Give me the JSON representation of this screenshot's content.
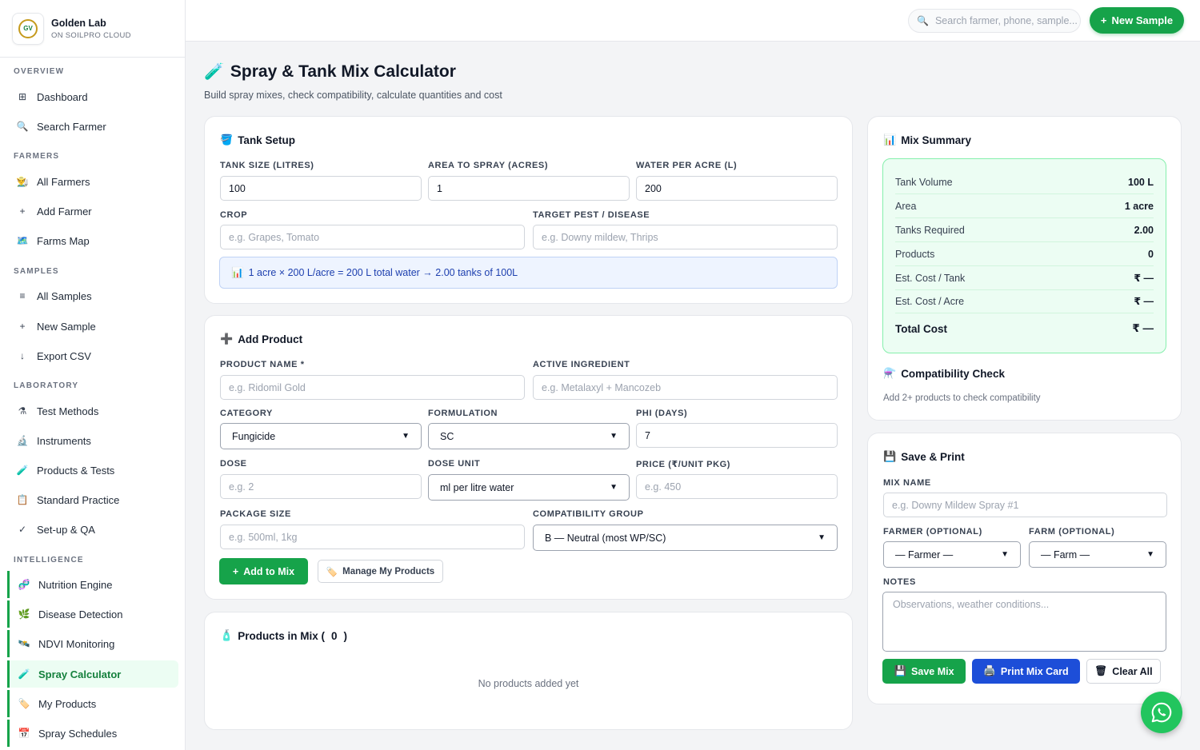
{
  "brand": {
    "name": "Golden Lab",
    "subtitle": "ON SOILPRO CLOUD",
    "logo_text": "GV"
  },
  "nav": {
    "sections": {
      "overview": "OVERVIEW",
      "farmers": "FARMERS",
      "samples": "SAMPLES",
      "laboratory": "LABORATORY",
      "intelligence": "INTELLIGENCE"
    },
    "items": {
      "dashboard": {
        "label": "Dashboard",
        "icon": "grid-icon",
        "glyph": "⊞"
      },
      "search_farmer": {
        "label": "Search Farmer",
        "icon": "search-icon",
        "glyph": "🔍"
      },
      "all_farmers": {
        "label": "All Farmers",
        "icon": "farmer-icon",
        "glyph": "👨‍🌾"
      },
      "add_farmer": {
        "label": "Add Farmer",
        "icon": "plus-icon",
        "glyph": "+"
      },
      "farms_map": {
        "label": "Farms Map",
        "icon": "map-icon",
        "glyph": "🗺️"
      },
      "all_samples": {
        "label": "All Samples",
        "icon": "list-icon",
        "glyph": "≡"
      },
      "new_sample": {
        "label": "New Sample",
        "icon": "plus-icon",
        "glyph": "+"
      },
      "export_csv": {
        "label": "Export CSV",
        "icon": "download-icon",
        "glyph": "↓"
      },
      "test_methods": {
        "label": "Test Methods",
        "icon": "flask-icon",
        "glyph": "⚗"
      },
      "instruments": {
        "label": "Instruments",
        "icon": "microscope-icon",
        "glyph": "🔬"
      },
      "products_tests": {
        "label": "Products & Tests",
        "icon": "test-tube-icon",
        "glyph": "🧪"
      },
      "standard_practice": {
        "label": "Standard Practice",
        "icon": "clipboard-icon",
        "glyph": "📋"
      },
      "setup_qa": {
        "label": "Set-up & QA",
        "icon": "check-icon",
        "glyph": "✓"
      },
      "nutrition_engine": {
        "label": "Nutrition Engine",
        "icon": "dna-icon",
        "glyph": "🧬"
      },
      "disease_detection": {
        "label": "Disease Detection",
        "icon": "leaf-icon",
        "glyph": "🌿"
      },
      "ndvi_monitoring": {
        "label": "NDVI Monitoring",
        "icon": "satellite-icon",
        "glyph": "🛰️"
      },
      "spray_calculator": {
        "label": "Spray Calculator",
        "icon": "test-tube-icon",
        "glyph": "🧪"
      },
      "my_products": {
        "label": "My Products",
        "icon": "tag-icon",
        "glyph": "🏷️"
      },
      "spray_schedules": {
        "label": "Spray Schedules",
        "icon": "calendar-icon",
        "glyph": "📅"
      }
    }
  },
  "topbar": {
    "search_placeholder": "Search farmer, phone, sample...",
    "new_sample_label": "New Sample"
  },
  "page": {
    "title": "Spray & Tank Mix Calculator",
    "title_icon": "🧪",
    "subtitle": "Build spray mixes, check compatibility, calculate quantities and cost"
  },
  "tank_setup": {
    "title": "Tank Setup",
    "icon": "🪣",
    "tank_size_label": "TANK SIZE (LITRES)",
    "tank_size_value": "100",
    "area_label": "AREA TO SPRAY (ACRES)",
    "area_value": "1",
    "water_label": "WATER PER ACRE (L)",
    "water_value": "200",
    "crop_label": "CROP",
    "crop_placeholder": "e.g. Grapes, Tomato",
    "pest_label": "TARGET PEST / DISEASE",
    "pest_placeholder": "e.g. Downy mildew, Thrips",
    "info_icon": "📊",
    "info_text": "1 acre × 200 L/acre = 200 L total water → 2.00 tanks of 100L"
  },
  "add_product": {
    "title": "Add Product",
    "icon": "➕",
    "name_label": "PRODUCT NAME *",
    "name_placeholder": "e.g. Ridomil Gold",
    "ai_label": "ACTIVE INGREDIENT",
    "ai_placeholder": "e.g. Metalaxyl + Mancozeb",
    "category_label": "CATEGORY",
    "category_value": "Fungicide",
    "formulation_label": "FORMULATION",
    "formulation_value": "SC",
    "phi_label": "PHI (DAYS)",
    "phi_value": "7",
    "dose_label": "DOSE",
    "dose_placeholder": "e.g. 2",
    "dose_unit_label": "DOSE UNIT",
    "dose_unit_value": "ml per litre water",
    "price_label": "PRICE (₹/UNIT PKG)",
    "price_placeholder": "e.g. 450",
    "package_label": "PACKAGE SIZE",
    "package_placeholder": "e.g. 500ml, 1kg",
    "compat_label": "COMPATIBILITY GROUP",
    "compat_value": "B — Neutral (most WP/SC)",
    "add_button": "Add to Mix",
    "manage_button": "Manage My Products",
    "manage_icon": "🏷️"
  },
  "products_in_mix": {
    "title_prefix": "Products in Mix (",
    "count": "0",
    "title_suffix": ")",
    "icon": "🧴",
    "empty_text": "No products added yet"
  },
  "mix_summary": {
    "title": "Mix Summary",
    "icon": "📊",
    "rows": [
      {
        "label": "Tank Volume",
        "value": "100 L"
      },
      {
        "label": "Area",
        "value": "1 acre"
      },
      {
        "label": "Tanks Required",
        "value": "2.00"
      },
      {
        "label": "Products",
        "value": "0"
      },
      {
        "label": "Est. Cost / Tank",
        "value": "₹ —"
      },
      {
        "label": "Est. Cost / Acre",
        "value": "₹ —"
      },
      {
        "label": "Total Cost",
        "value": "₹ —"
      }
    ]
  },
  "compatibility": {
    "title": "Compatibility Check",
    "icon": "⚗️",
    "hint": "Add 2+ products to check compatibility"
  },
  "save_print": {
    "title": "Save & Print",
    "icon": "💾",
    "mix_name_label": "MIX NAME",
    "mix_name_placeholder": "e.g. Downy Mildew Spray #1",
    "farmer_label": "FARMER (OPTIONAL)",
    "farmer_value": "— Farmer —",
    "farm_label": "FARM (OPTIONAL)",
    "farm_value": "— Farm —",
    "notes_label": "NOTES",
    "notes_placeholder": "Observations, weather conditions...",
    "save_button": "Save Mix",
    "save_icon": "💾",
    "print_button": "Print Mix Card",
    "print_icon": "🖨️",
    "clear_button": "Clear All",
    "clear_icon": "🗑"
  },
  "colors": {
    "primary_green": "#16a34a",
    "primary_blue": "#1d4ed8",
    "whatsapp": "#22c55e"
  }
}
